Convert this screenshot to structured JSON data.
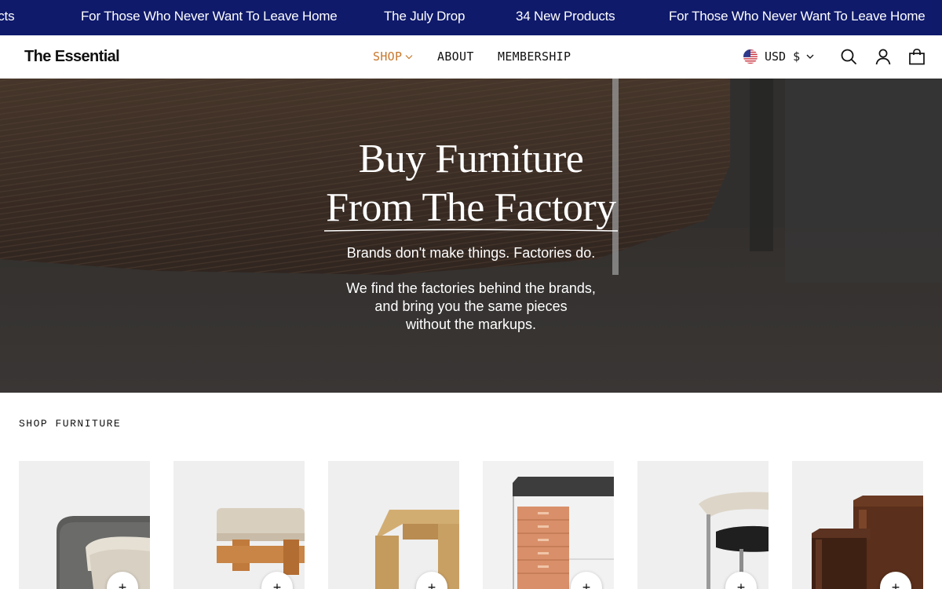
{
  "announcement": {
    "items": [
      "ucts",
      "For Those Who Never Want To Leave Home",
      "The July Drop",
      "34 New Products",
      "For Those Who Never Want To Leave Home"
    ],
    "background": "#0f1a6b"
  },
  "header": {
    "logo": "The Essential",
    "nav": [
      {
        "label": "SHOP",
        "active": true,
        "has_dropdown": true
      },
      {
        "label": "ABOUT"
      },
      {
        "label": "MEMBERSHIP"
      }
    ],
    "currency": "USD $",
    "icons": [
      "us-flag-icon",
      "chevron-down-icon",
      "search-icon",
      "account-icon",
      "cart-icon"
    ],
    "accent": "#c9772b"
  },
  "hero": {
    "title_line1": "Buy Furniture",
    "title_line2": "From The Factory",
    "tagline": "Brands don't make things. Factories do.",
    "body_line1": "We find the factories behind the brands,",
    "body_line2": "and bring you the same pieces",
    "body_line3": "without the markups."
  },
  "shop": {
    "label": "SHOP FURNITURE",
    "cards": [
      {
        "product": "bed",
        "button_icon": "plus-icon"
      },
      {
        "product": "bench",
        "button_icon": "plus-icon"
      },
      {
        "product": "wood-table",
        "button_icon": "plus-icon"
      },
      {
        "product": "desk-with-drawers",
        "button_icon": "plus-icon"
      },
      {
        "product": "chair",
        "button_icon": "plus-icon"
      },
      {
        "product": "wood-side-tables",
        "button_icon": "plus-icon"
      }
    ]
  }
}
